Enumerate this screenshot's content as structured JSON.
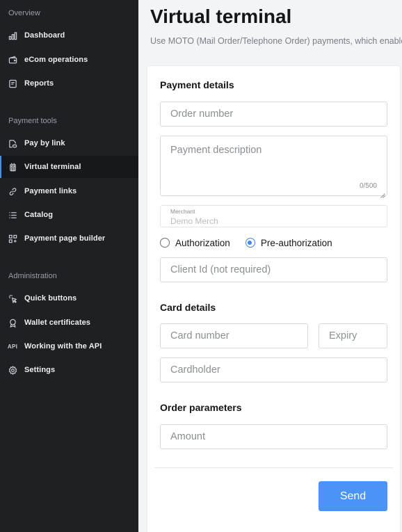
{
  "sidebar": {
    "sections": [
      {
        "title": "Overview"
      },
      {
        "title": "Payment tools"
      },
      {
        "title": "Administration"
      }
    ],
    "items": [
      {
        "label": "Dashboard",
        "icon": "bar-chart-icon"
      },
      {
        "label": "eCom operations",
        "icon": "wallet-icon"
      },
      {
        "label": "Reports",
        "icon": "document-icon"
      },
      {
        "label": "Pay by link",
        "icon": "link-page-icon"
      },
      {
        "label": "Virtual terminal",
        "icon": "terminal-icon",
        "active": true
      },
      {
        "label": "Payment links",
        "icon": "link-icon"
      },
      {
        "label": "Catalog",
        "icon": "list-icon"
      },
      {
        "label": "Payment page builder",
        "icon": "grid-icon"
      },
      {
        "label": "Quick buttons",
        "icon": "click-icon"
      },
      {
        "label": "Wallet certificates",
        "icon": "certificate-icon"
      },
      {
        "label": "Working with the API",
        "icon": "api-icon",
        "icon_text": "API"
      },
      {
        "label": "Settings",
        "icon": "gear-icon"
      }
    ],
    "accent_color": "#4a8cf0"
  },
  "main": {
    "title": "Virtual terminal",
    "subtitle": "Use MOTO (Mail Order/Telephone Order) payments, which enable"
  },
  "form": {
    "payment_details": {
      "heading": "Payment details",
      "order_number_placeholder": "Order number",
      "description_placeholder": "Payment description",
      "description_counter": "0/500",
      "merchant_label": "Merchant",
      "merchant_value": "Demo Merch",
      "radio_authorization": "Authorization",
      "radio_preauthorization": "Pre-authorization",
      "selected_radio": "Pre-authorization",
      "client_id_placeholder": "Client Id (not required)"
    },
    "card_details": {
      "heading": "Card details",
      "card_number_placeholder": "Card number",
      "expiry_placeholder": "Expiry",
      "cardholder_placeholder": "Cardholder"
    },
    "order_parameters": {
      "heading": "Order parameters",
      "amount_placeholder": "Amount"
    },
    "send_label": "Send",
    "send_color": "#4b93f7"
  }
}
